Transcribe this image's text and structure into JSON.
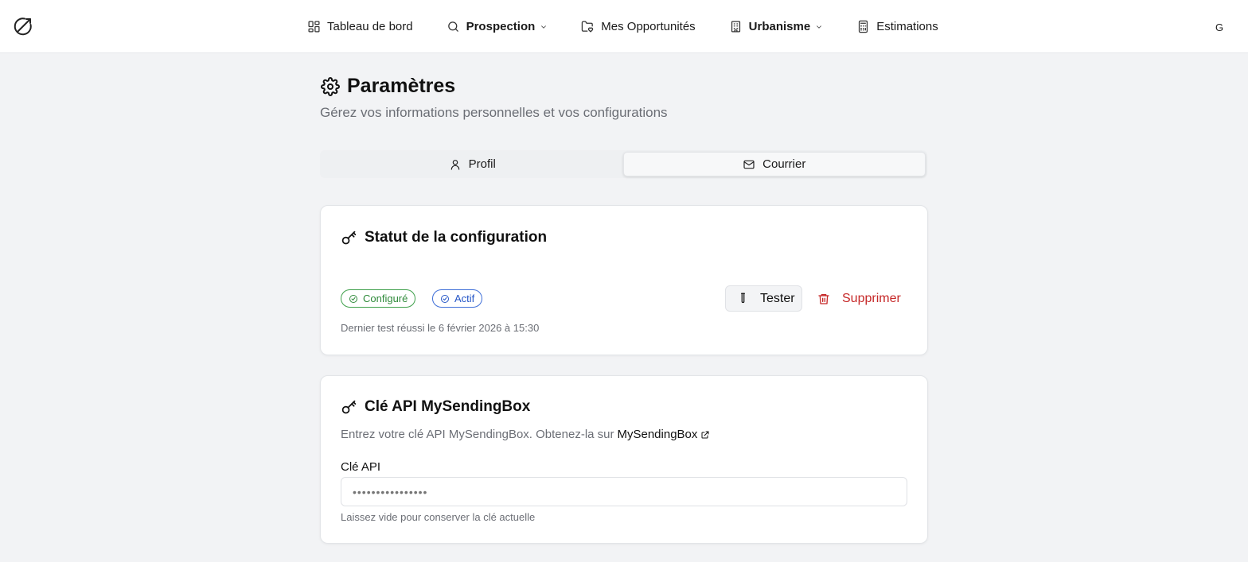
{
  "nav": {
    "items": [
      {
        "label": "Tableau de bord"
      },
      {
        "label": "Prospection"
      },
      {
        "label": "Mes Opportunités"
      },
      {
        "label": "Urbanisme"
      },
      {
        "label": "Estimations"
      }
    ],
    "avatar": "G"
  },
  "page": {
    "title": "Paramètres",
    "subtitle": "Gérez vos informations personnelles et vos configurations"
  },
  "tabs": [
    {
      "label": "Profil",
      "active": false
    },
    {
      "label": "Courrier",
      "active": true
    }
  ],
  "status_card": {
    "title": "Statut de la configuration",
    "badge_configured": "Configuré",
    "badge_active": "Actif",
    "test_button": "Tester",
    "delete_button": "Supprimer",
    "last_test": "Dernier test réussi le 6 février 2026 à 15:30",
    "colors": {
      "green": "#2f8a3a",
      "blue": "#2556c7",
      "danger": "#c62828"
    }
  },
  "api_card": {
    "title": "Clé API MySendingBox",
    "description": "Entrez votre clé API MySendingBox. Obtenez-la sur",
    "link_label": "MySendingBox",
    "field_label": "Clé API",
    "field_placeholder": "••••••••••••••••",
    "help": "Laissez vide pour conserver la clé actuelle"
  }
}
